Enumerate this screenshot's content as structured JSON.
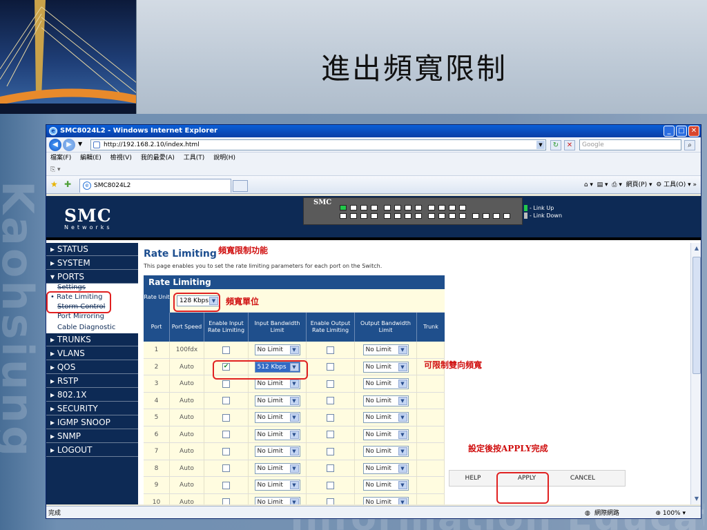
{
  "slide": {
    "title": "進出頻寬限制",
    "watermark": "Kaohsiung",
    "bottom_text": "Information Education"
  },
  "browser": {
    "window_title": "SMC8024L2 - Windows Internet Explorer",
    "url": "http://192.168.2.10/index.html",
    "search_placeholder": "Google",
    "menu": [
      "檔案(F)",
      "編輯(E)",
      "檢視(V)",
      "我的最愛(A)",
      "工具(T)",
      "說明(H)"
    ],
    "tab_label": "SMC8024L2",
    "page_menu": "網頁(P)",
    "tools_menu": "工具(O)",
    "status_left": "完成",
    "status_zone": "網際網路",
    "zoom": "100%"
  },
  "banner": {
    "logo": "SMC",
    "logo_sub": "Networks",
    "switch_label": "SMC",
    "legend_up": "- Link Up",
    "legend_down": "- Link Down"
  },
  "sidebar": {
    "items": [
      "STATUS",
      "SYSTEM",
      "PORTS",
      "TRUNKS",
      "VLANS",
      "QOS",
      "RSTP",
      "802.1X",
      "SECURITY",
      "IGMP SNOOP",
      "SNMP",
      "LOGOUT"
    ],
    "ports_sub": [
      "Settings",
      "Rate Limiting",
      "Storm Control",
      "Port Mirroring",
      "Cable Diagnostic"
    ]
  },
  "content": {
    "heading": "Rate Limiting",
    "description": "This page enables you to set the rate limiting parameters for each port on the Switch.",
    "panel_title": "Rate Limiting",
    "rate_unit_label": "Rate Unit",
    "rate_unit_value": "128 Kbps",
    "columns": [
      "Port",
      "Port Speed",
      "Enable Input Rate Limiting",
      "Input Bandwidth Limit",
      "Enable Output Rate Limiting",
      "Output Bandwidth Limit",
      "Trunk"
    ],
    "rows": [
      {
        "port": "1",
        "speed": "100fdx",
        "in_en": false,
        "in_bw": "No Limit",
        "out_en": false,
        "out_bw": "No Limit"
      },
      {
        "port": "2",
        "speed": "Auto",
        "in_en": true,
        "in_bw": "512 Kbps",
        "out_en": false,
        "out_bw": "No Limit"
      },
      {
        "port": "3",
        "speed": "Auto",
        "in_en": false,
        "in_bw": "No Limit",
        "out_en": false,
        "out_bw": "No Limit"
      },
      {
        "port": "4",
        "speed": "Auto",
        "in_en": false,
        "in_bw": "No Limit",
        "out_en": false,
        "out_bw": "No Limit"
      },
      {
        "port": "5",
        "speed": "Auto",
        "in_en": false,
        "in_bw": "No Limit",
        "out_en": false,
        "out_bw": "No Limit"
      },
      {
        "port": "6",
        "speed": "Auto",
        "in_en": false,
        "in_bw": "No Limit",
        "out_en": false,
        "out_bw": "No Limit"
      },
      {
        "port": "7",
        "speed": "Auto",
        "in_en": false,
        "in_bw": "No Limit",
        "out_en": false,
        "out_bw": "No Limit"
      },
      {
        "port": "8",
        "speed": "Auto",
        "in_en": false,
        "in_bw": "No Limit",
        "out_en": false,
        "out_bw": "No Limit"
      },
      {
        "port": "9",
        "speed": "Auto",
        "in_en": false,
        "in_bw": "No Limit",
        "out_en": false,
        "out_bw": "No Limit"
      },
      {
        "port": "10",
        "speed": "Auto",
        "in_en": false,
        "in_bw": "No Limit",
        "out_en": false,
        "out_bw": "No Limit"
      }
    ],
    "buttons": {
      "help": "HELP",
      "apply": "APPLY",
      "cancel": "CANCEL"
    }
  },
  "annotations": {
    "feature": "頻寬限制功能",
    "unit": "頻寬單位",
    "bidirectional": "可限制雙向頻寬",
    "apply_hint": "設定後按APPLY完成"
  },
  "colors": {
    "nav_background": "#0d2a55",
    "table_header": "#1f4f8c",
    "row_background": "#fffce0",
    "annotation_red": "#d01010"
  }
}
